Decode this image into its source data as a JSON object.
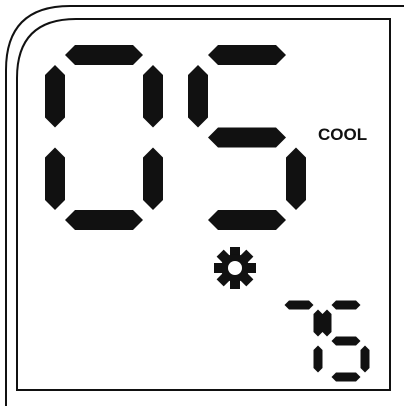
{
  "display": {
    "main_value": "05",
    "mode_label": "COOL",
    "setpoint_value": "75",
    "mode_icon": "gear-icon"
  },
  "colors": {
    "background": "#ffffff",
    "segment": "#111111",
    "border": "#111111"
  }
}
